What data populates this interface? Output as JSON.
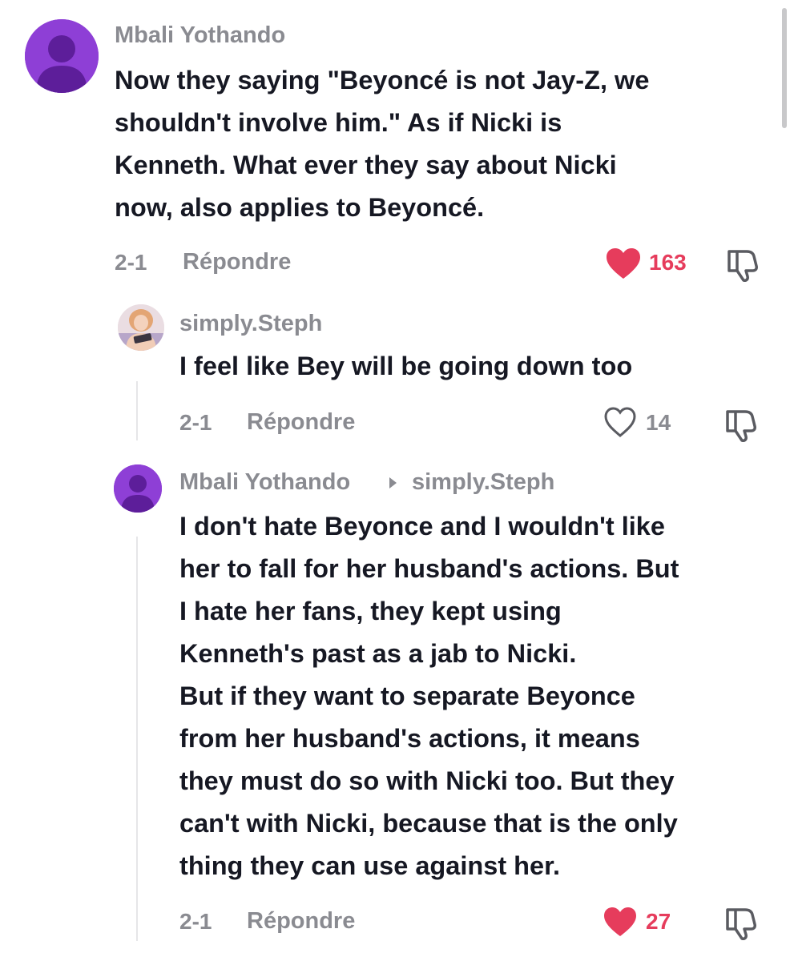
{
  "comments": [
    {
      "username": "Mbali Yothando",
      "text_lines": [
        "Now they saying \"Beyoncé is not Jay-Z, we",
        "shouldn't involve him.\" As if Nicki is",
        "Kenneth. What ever they say about Nicki",
        "now, also applies to Beyoncé."
      ],
      "date": "2-1",
      "reply_label": "Répondre",
      "likes": "163",
      "liked": true,
      "avatar_icon": "default-user-avatar-purple"
    },
    {
      "username": "simply.Steph",
      "text_lines": [
        "I feel like Bey will be going down too"
      ],
      "date": "2-1",
      "reply_label": "Répondre",
      "likes": "14",
      "liked": false,
      "avatar_icon": "user-photo-avatar"
    },
    {
      "username": "Mbali Yothando",
      "reply_to": "simply.Steph",
      "text_lines": [
        "I don't hate Beyonce and I wouldn't like",
        "her to fall for her husband's actions. But",
        "I hate her fans, they kept using",
        "Kenneth's past as a jab to Nicki.",
        "But if they want to separate Beyonce",
        "from her husband's actions, it means",
        "they must do so with Nicki too. But they",
        "can't with Nicki, because that is the only",
        "thing they can use against her."
      ],
      "date": "2-1",
      "reply_label": "Répondre",
      "likes": "27",
      "liked": true,
      "avatar_icon": "default-user-avatar-purple"
    }
  ],
  "colors": {
    "like_active": "#e63c5c",
    "muted_text": "#8a8b91",
    "primary_text": "#161823",
    "avatar_purple": "#8e3fd6"
  }
}
